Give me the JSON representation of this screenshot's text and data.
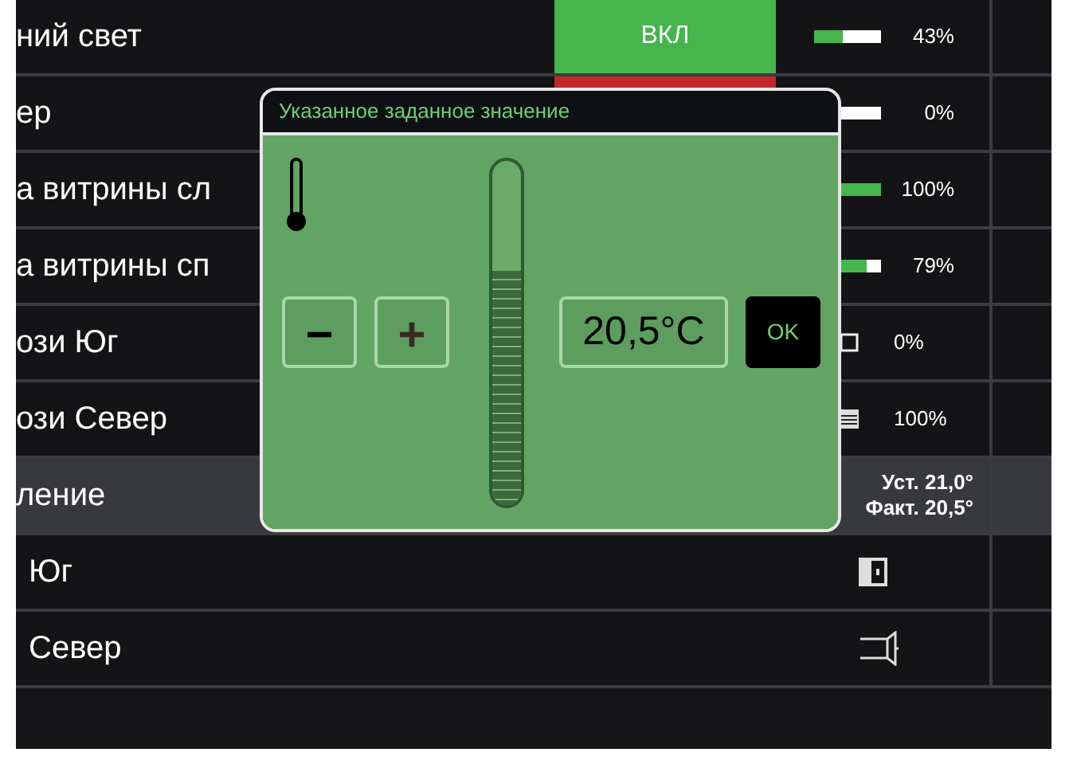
{
  "rows": [
    {
      "label": "ний свет",
      "control": {
        "kind": "button",
        "label": "ВКЛ",
        "on": true
      },
      "meter": {
        "level": 0.43,
        "reading": "43%"
      },
      "selected": false
    },
    {
      "label": "ер",
      "control": {
        "kind": "button",
        "on": false
      },
      "meter": {
        "level": 0,
        "reading": "0%"
      },
      "selected": false
    },
    {
      "label": "а витрины сл",
      "meter": {
        "level": 1,
        "reading": "100%"
      },
      "selected": false
    },
    {
      "label": "а витрины сп",
      "meter": {
        "level": 0.79,
        "reading": "79%"
      },
      "selected": false
    },
    {
      "label": "ози Юг",
      "status": {
        "kind": "square",
        "reading": "0%"
      },
      "selected": false
    },
    {
      "label": "ози Север",
      "status": {
        "kind": "lines",
        "reading": "100%"
      },
      "selected": false
    },
    {
      "label": "ление",
      "readings": [
        "Уст. 21,0°",
        "Факт. 20,5°"
      ],
      "selected": true
    },
    {
      "label": "Юг",
      "status": {
        "kind": "window"
      },
      "selected": false
    },
    {
      "label": "Север",
      "status": {
        "kind": "door"
      },
      "selected": false
    }
  ],
  "dialog": {
    "title": "Указанное заданное значение",
    "slider": {
      "level": 0.68
    },
    "minus": "−",
    "plus": "+",
    "value": "20,5°C",
    "ok": "OK"
  }
}
